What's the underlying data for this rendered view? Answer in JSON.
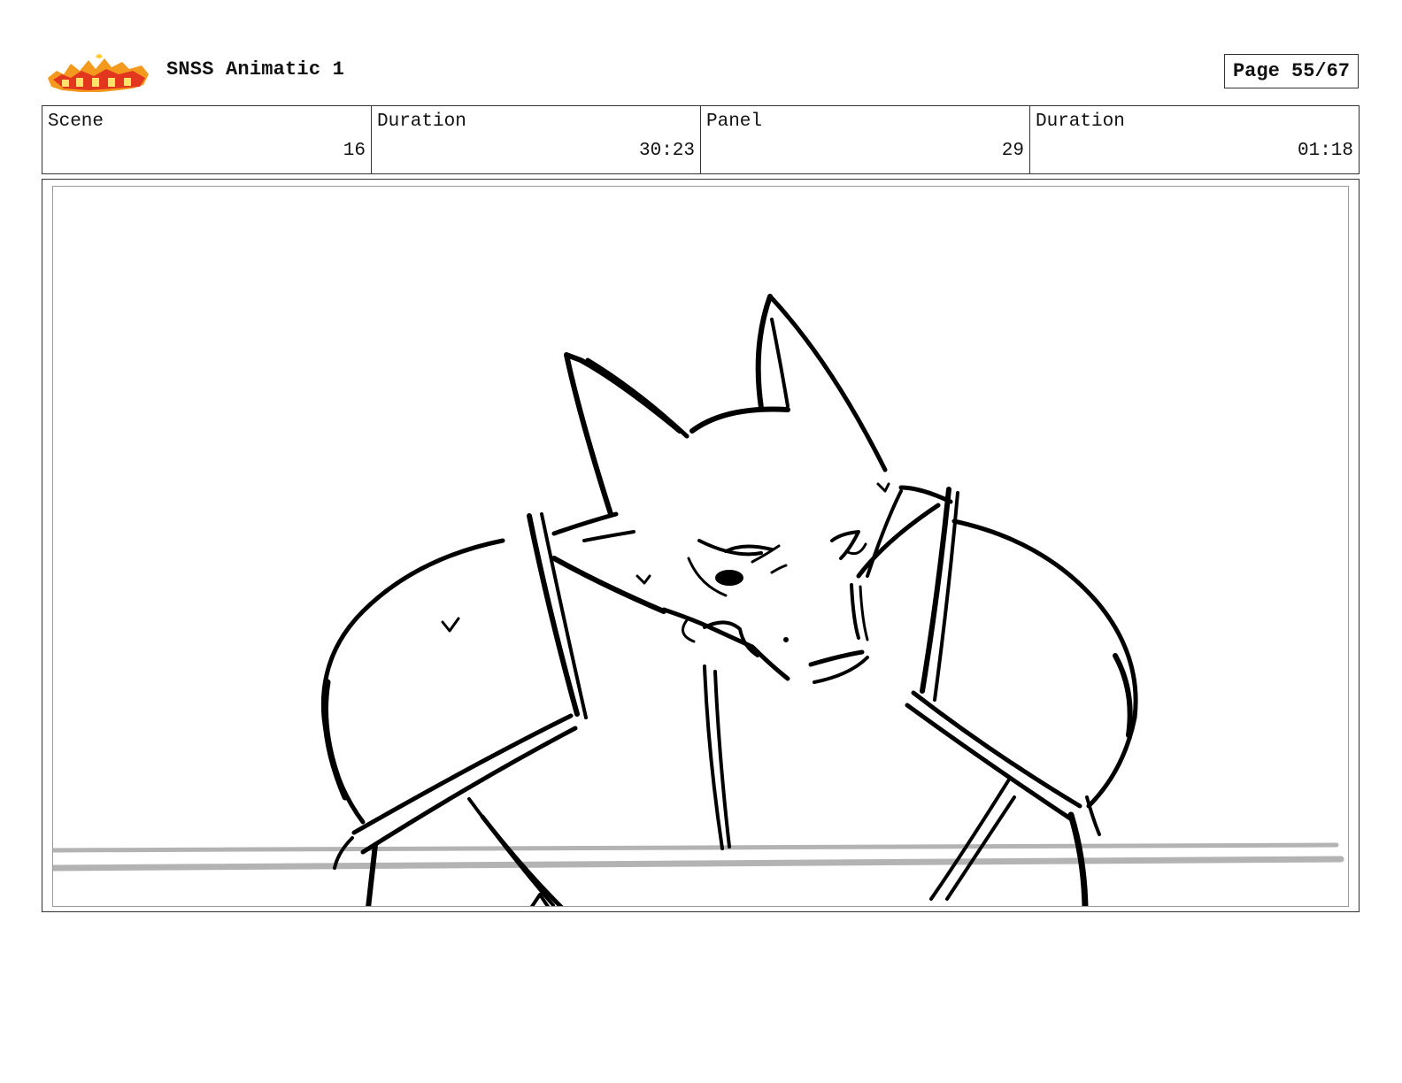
{
  "header": {
    "logo_icon": "show-logo",
    "title": "SNSS Animatic 1",
    "page_label": "Page 55/67"
  },
  "info": {
    "scene_label": "Scene",
    "scene_value": "16",
    "scene_duration_label": "Duration",
    "scene_duration_value": "30:23",
    "panel_label": "Panel",
    "panel_value": "29",
    "panel_duration_label": "Duration",
    "panel_duration_value": "01:18"
  },
  "panel": {
    "image_icon": "storyboard-sketch-image"
  }
}
